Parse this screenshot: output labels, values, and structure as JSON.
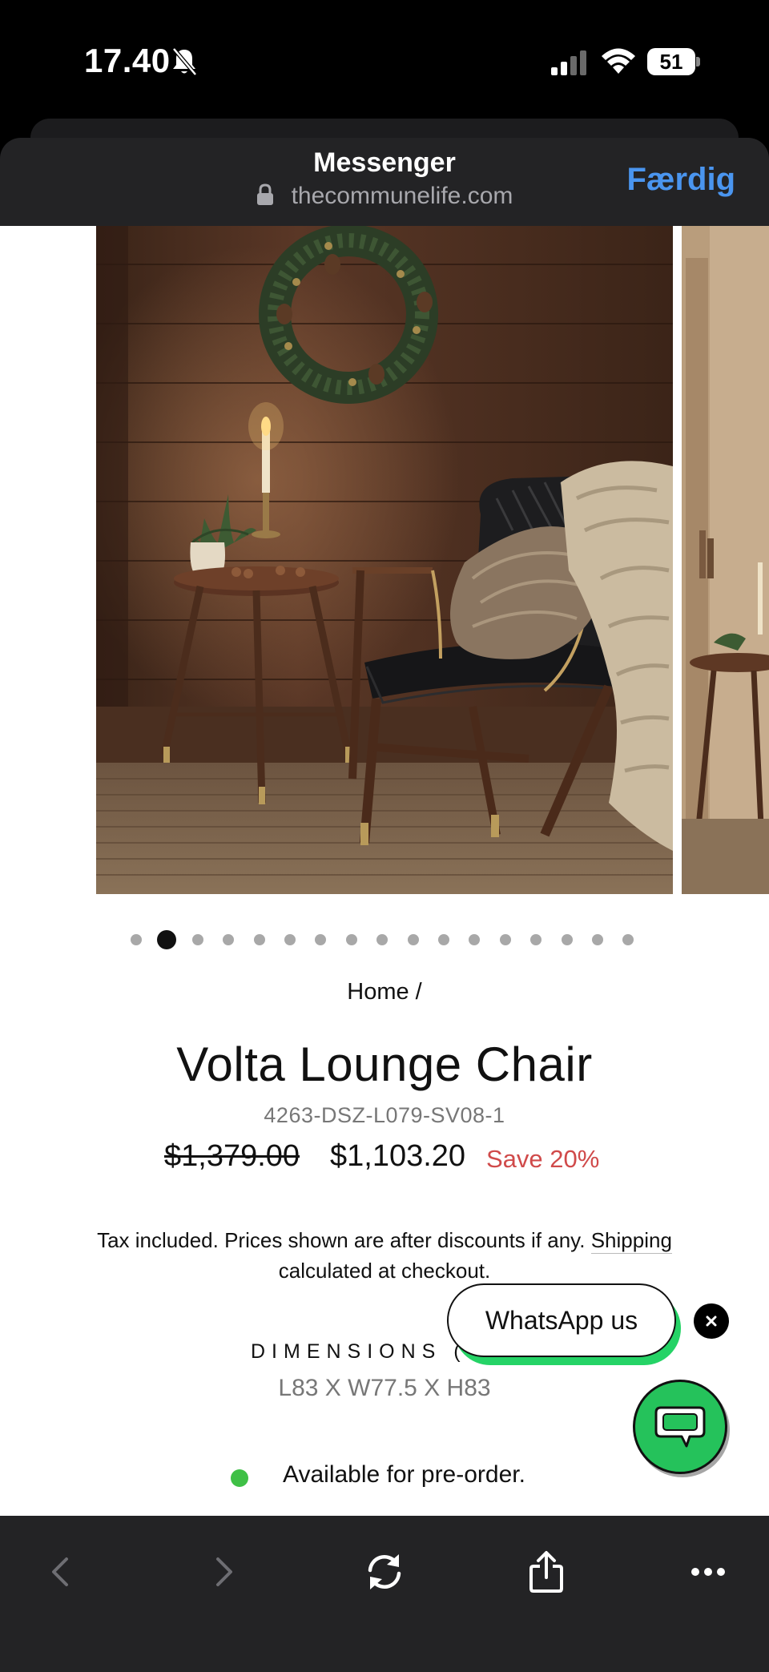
{
  "status_bar": {
    "time": "17.40",
    "battery": "51",
    "icons": [
      "bell-slash-icon",
      "signal-icon",
      "wifi-icon",
      "battery-icon"
    ]
  },
  "browser": {
    "title": "Messenger",
    "url": "thecommunelife.com",
    "done_label": "Færdig"
  },
  "gallery": {
    "slide_count": 17,
    "active_index": 1,
    "zoom_icon": "search-icon"
  },
  "product": {
    "breadcrumb": "Home /",
    "title": "Volta Lounge Chair",
    "sku": "4263-DSZ-L079-SV08-1",
    "price_original": "$1,379.00",
    "price_sale": "$1,103.20",
    "savings": "Save 20%",
    "tax_text": "Tax included. Prices shown are after discounts if any.",
    "tax_link": "Shipping",
    "tax_text_end": "calculated at checkout.",
    "dimensions_label": "DIMENSIONS (",
    "dimensions_value": "L83 X W77.5 X H83",
    "availability": "Available for pre-order."
  },
  "whatsapp": {
    "label": "WhatsApp us",
    "close_icon": "close-icon",
    "fab_icon": "chat-bubble-icon"
  },
  "toolbar": {
    "icons": [
      "back-icon",
      "forward-icon",
      "reload-icon",
      "share-icon",
      "more-icon"
    ]
  },
  "colors": {
    "accent_blue": "#4a95ef",
    "sale_red": "#d04a4a",
    "whatsapp_green": "#25c25b",
    "availability_green": "#3fc046"
  }
}
